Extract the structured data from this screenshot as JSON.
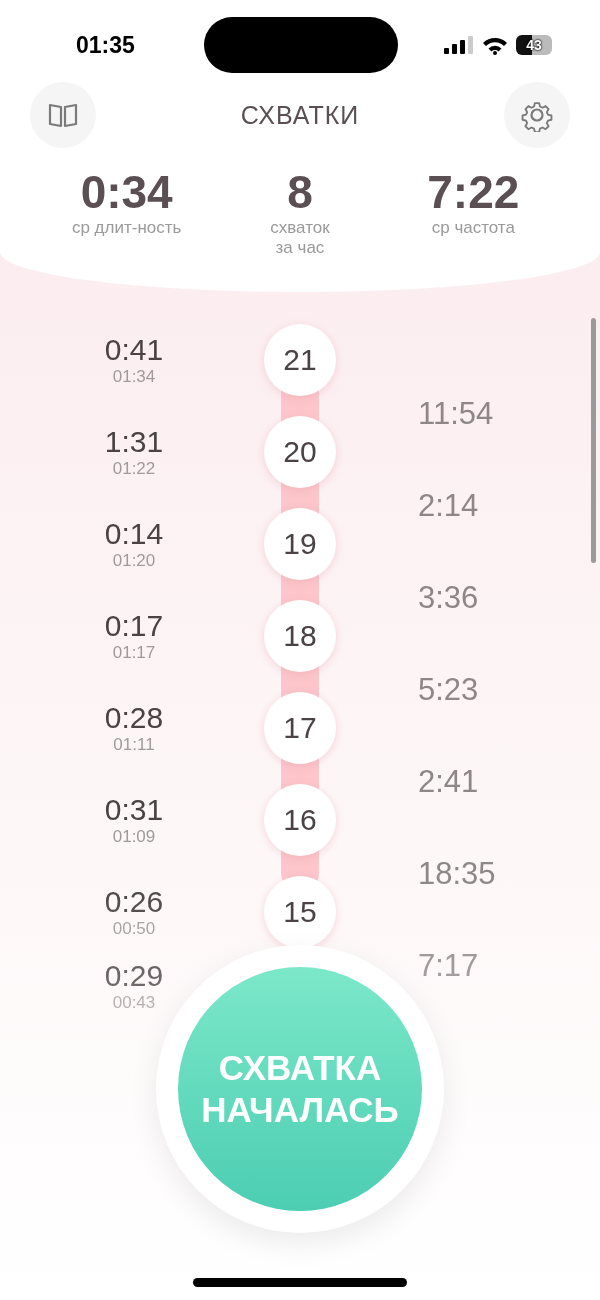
{
  "status_bar": {
    "time": "01:35",
    "battery": "43"
  },
  "header": {
    "title": "СХВАТКИ"
  },
  "stats": [
    {
      "value": "0:34",
      "label": "ср длит-ность"
    },
    {
      "value": "8",
      "label": "схваток за час"
    },
    {
      "value": "7:22",
      "label": "ср частота"
    }
  ],
  "contractions": [
    {
      "number": "21",
      "duration": "0:41",
      "start": "01:34",
      "interval": "11:54"
    },
    {
      "number": "20",
      "duration": "1:31",
      "start": "01:22",
      "interval": "2:14"
    },
    {
      "number": "19",
      "duration": "0:14",
      "start": "01:20",
      "interval": "3:36"
    },
    {
      "number": "18",
      "duration": "0:17",
      "start": "01:17",
      "interval": "5:23"
    },
    {
      "number": "17",
      "duration": "0:28",
      "start": "01:11",
      "interval": "2:41"
    },
    {
      "number": "16",
      "duration": "0:31",
      "start": "01:09",
      "interval": "18:35"
    },
    {
      "number": "15",
      "duration": "0:26",
      "start": "00:50",
      "interval": "7:17"
    },
    {
      "duration": "0:29",
      "start": "00:43"
    }
  ],
  "start_button": {
    "line1": "СХВАТКА",
    "line2": "НАЧАЛАСЬ"
  }
}
